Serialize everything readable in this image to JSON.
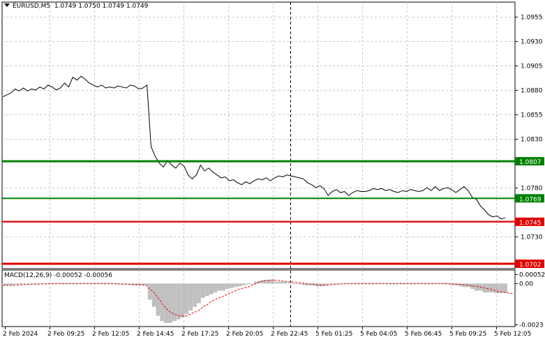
{
  "header": {
    "symbol": "EURUSD,M5",
    "ohlc": "1.0749 1.0750 1.0749 1.0749"
  },
  "macd": {
    "label": "MACD(12,26,9) -0.00052 -0.00056"
  },
  "colors": {
    "background": "#ffffff",
    "grid": "#c8c8c8",
    "price_line": "#000000",
    "resistance": "#008000",
    "support": "#e00000",
    "histogram": "#c0c0c0",
    "signal": "#e00000"
  },
  "chart_data": [
    {
      "type": "line",
      "title": "EURUSD,M5",
      "y_ticks": [
        "1.0955",
        "1.0930",
        "1.0905",
        "1.0880",
        "1.0855",
        "1.0830",
        "1.0780",
        "1.0730"
      ],
      "x_ticks": [
        "2 Feb 2024",
        "2 Feb 09:25",
        "2 Feb 12:05",
        "2 Feb 14:45",
        "2 Feb 17:25",
        "2 Feb 20:05",
        "2 Feb 22:45",
        "5 Feb 01:25",
        "5 Feb 04:05",
        "5 Feb 06:45",
        "5 Feb 09:25",
        "5 Feb 12:05"
      ],
      "ylim": [
        1.0697,
        1.097
      ],
      "grid": true,
      "levels": [
        {
          "label": "1.0807",
          "value": 1.0807,
          "color": "#008000"
        },
        {
          "label": "1.0769",
          "value": 1.0769,
          "color": "#008000"
        },
        {
          "label": "1.0745",
          "value": 1.0745,
          "color": "#e00000"
        },
        {
          "label": "1.0702",
          "value": 1.0702,
          "color": "#e00000"
        }
      ],
      "series": [
        {
          "values": [
            1.0873,
            1.0875,
            1.0877,
            1.0881,
            1.0879,
            1.0882,
            1.0879,
            1.0881,
            1.088,
            1.0883,
            1.0881,
            1.0885,
            1.0883,
            1.088,
            1.0882,
            1.0887,
            1.0883,
            1.0893,
            1.089,
            1.0894,
            1.0891,
            1.0887,
            1.0885,
            1.0883,
            1.0885,
            1.0882,
            1.0883,
            1.0882,
            1.0884,
            1.0883,
            1.0882,
            1.0885,
            1.0884,
            1.0881,
            1.0882,
            1.0885,
            1.0822,
            1.0812,
            1.0805,
            1.0801,
            1.0808,
            1.0803,
            1.08,
            1.0805,
            1.0802,
            1.0793,
            1.0789,
            1.0793,
            1.0803,
            1.0797,
            1.08,
            1.0796,
            1.0793,
            1.079,
            1.0791,
            1.0787,
            1.0788,
            1.0785,
            1.0783,
            1.0786,
            1.0784,
            1.0787,
            1.0789,
            1.0788,
            1.079,
            1.0787,
            1.079,
            1.0792,
            1.0791,
            1.0793,
            1.0792,
            1.0791,
            1.079,
            1.0789,
            1.0785,
            1.0783,
            1.078,
            1.0782,
            1.0779,
            1.0772,
            1.0776,
            1.0778,
            1.0775,
            1.0776,
            1.0772,
            1.0775,
            1.0777,
            1.0776,
            1.0776,
            1.0777,
            1.0779,
            1.0778,
            1.0779,
            1.0777,
            1.0778,
            1.0776,
            1.0775,
            1.0777,
            1.0776,
            1.0778,
            1.0777,
            1.0776,
            1.0777,
            1.078,
            1.0777,
            1.0781,
            1.0777,
            1.0779,
            1.078,
            1.0778,
            1.0775,
            1.0778,
            1.0781,
            1.0777,
            1.077,
            1.0768,
            1.0761,
            1.0757,
            1.0752,
            1.075,
            1.0751,
            1.0748,
            1.0749
          ]
        }
      ]
    },
    {
      "type": "bar",
      "title": "MACD(12,26,9)",
      "y_ticks": [
        "0.00052",
        "0.00",
        "-0.0023"
      ],
      "ylim": [
        -0.0024,
        0.00075
      ],
      "series": [
        {
          "name": "MACD",
          "values": [
            -0.0001,
            -0.0001,
            -0.0001,
            -5e-05,
            -5e-05,
            0,
            0,
            0,
            -5e-05,
            0,
            0,
            0,
            0,
            0,
            0,
            0,
            0,
            0,
            0,
            0,
            0,
            0,
            0,
            0,
            0,
            0,
            0,
            0,
            -5e-05,
            -5e-05,
            -5e-05,
            -5e-05,
            -0.0001,
            -0.0001,
            -0.0001,
            -0.0001,
            -0.0009,
            -0.0013,
            -0.0018,
            -0.0021,
            -0.0022,
            -0.0022,
            -0.0021,
            -0.002,
            -0.0019,
            -0.0017,
            -0.0015,
            -0.0013,
            -0.0011,
            -0.0008,
            -0.0007,
            -0.0006,
            -0.0005,
            -0.0004,
            -0.0004,
            -0.0003,
            -0.00025,
            -0.0002,
            -0.00015,
            -0.0001,
            -5e-05,
            0,
            0.0001,
            0.00015,
            0.0002,
            0.0002,
            0.0002,
            0.0001,
            0.0001,
            0.0001,
            5e-05,
            0,
            0,
            -5e-05,
            -0.0001,
            -0.0001,
            -0.0001,
            -0.00015,
            -0.00015,
            -0.0001,
            -5e-05,
            0,
            0,
            0,
            0,
            0,
            0,
            0,
            0,
            0,
            0,
            0,
            0,
            0,
            0,
            0,
            0,
            0,
            0,
            0,
            0,
            0,
            0,
            0,
            0,
            0,
            0,
            0,
            -5e-05,
            -5e-05,
            -0.0001,
            -0.0001,
            -0.00015,
            -0.0002,
            -0.0002,
            -0.0003,
            -0.0004,
            -0.0004,
            -0.0005,
            -0.0005,
            -0.0005,
            -0.00055,
            -0.00052,
            -0.00052
          ]
        },
        {
          "name": "Signal",
          "values": [
            -0.0001,
            -0.0001,
            -0.0001,
            -0.0001,
            -8e-05,
            -6e-05,
            -5e-05,
            -4e-05,
            -4e-05,
            -3e-05,
            -2e-05,
            -2e-05,
            -1e-05,
            0,
            0,
            0,
            0,
            0,
            0,
            0,
            0,
            0,
            0,
            0,
            0,
            0,
            0,
            0,
            -2e-05,
            -3e-05,
            -4e-05,
            -5e-05,
            -6e-05,
            -7e-05,
            -8e-05,
            -9e-05,
            -0.0003,
            -0.0005,
            -0.0008,
            -0.0011,
            -0.0014,
            -0.0016,
            -0.0017,
            -0.0018,
            -0.0018,
            -0.0018,
            -0.0017,
            -0.0016,
            -0.0015,
            -0.0013,
            -0.0012,
            -0.001,
            -0.0009,
            -0.0008,
            -0.0007,
            -0.0006,
            -0.0005,
            -0.0004,
            -0.0003,
            -0.00025,
            -0.0002,
            -0.0001,
            0,
            0.0001,
            0.00015,
            0.00018,
            0.0002,
            0.00018,
            0.00015,
            0.00012,
            0.0001,
            8e-05,
            5e-05,
            3e-05,
            0,
            -3e-05,
            -5e-05,
            -8e-05,
            -0.0001,
            -0.0001,
            -8e-05,
            -6e-05,
            -4e-05,
            -2e-05,
            0,
            0,
            0,
            0,
            0,
            0,
            0,
            0,
            0,
            0,
            0,
            0,
            0,
            0,
            0,
            0,
            0,
            0,
            0,
            0,
            0,
            0,
            0,
            0,
            0,
            0,
            -2e-05,
            -3e-05,
            -5e-05,
            -7e-05,
            -0.0001,
            -0.00013,
            -0.00016,
            -0.0002,
            -0.00025,
            -0.0003,
            -0.00036,
            -0.00042,
            -0.00047,
            -0.0005,
            -0.00054,
            -0.00056
          ]
        }
      ]
    }
  ]
}
